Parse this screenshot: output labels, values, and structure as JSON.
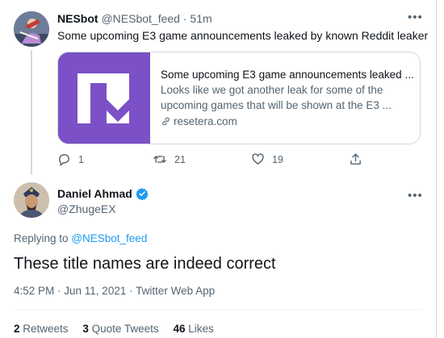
{
  "parent_tweet": {
    "author_name": "NESbot",
    "author_handle": "@NESbot_feed",
    "time": "51m",
    "separator": "·",
    "text": "Some upcoming E3 game announcements leaked by known Reddit leaker",
    "more_icon": "more-icon",
    "card": {
      "title": "Some upcoming E3 game announcements leaked ...",
      "description_line1": "Looks like we got another leak for some of the",
      "description_line2": "upcoming games that will be shown at the E3 ...",
      "domain": "resetera.com",
      "image_color": "#7c50c7",
      "link_icon": "link-icon"
    },
    "actions": {
      "reply_count": "1",
      "retweet_count": "21",
      "like_count": "19"
    }
  },
  "main_tweet": {
    "author_name": "Daniel Ahmad",
    "author_handle": "@ZhugeEX",
    "verified_icon": "verified-badge-icon",
    "replying_prefix": "Replying to",
    "replying_to": "@NESbot_feed",
    "text": "These title names are indeed correct",
    "timestamp": "4:52 PM · Jun 11, 2021 · Twitter Web App",
    "stats": {
      "retweets_count": "2",
      "retweets_label": "Retweets",
      "quotes_count": "3",
      "quotes_label": "Quote Tweets",
      "likes_count": "46",
      "likes_label": "Likes"
    }
  },
  "colors": {
    "link_blue": "#1d9bf0",
    "secondary_text": "#536471",
    "border": "#cfd9de",
    "card_purple": "#7c50c7"
  }
}
